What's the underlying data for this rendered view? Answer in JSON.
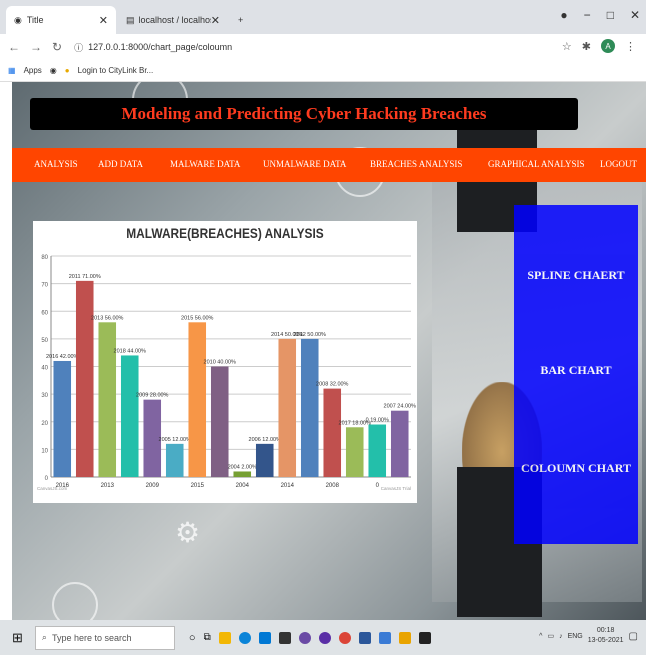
{
  "browser": {
    "tabs": [
      {
        "label": "Title"
      },
      {
        "label": "localhost / localhost / hacking /"
      }
    ],
    "new_tab_label": "+",
    "url": "127.0.0.1:8000/chart_page/coloumn",
    "bookmarks": [
      {
        "label": "Apps"
      },
      {
        "label": "Login to CityLink Br..."
      }
    ],
    "avatar_letter": "A"
  },
  "page": {
    "title": "Modeling and Predicting Cyber Hacking Breaches",
    "menu": [
      {
        "label": "ANALYSIS"
      },
      {
        "label": "ADD DATA"
      },
      {
        "label": "MALWARE DATA"
      },
      {
        "label": "UNMALWARE DATA"
      },
      {
        "label": "BREACHES ANALYSIS"
      },
      {
        "label": "GRAPHICAL ANALYSIS"
      },
      {
        "label": "LOGOUT"
      }
    ],
    "side_links": [
      {
        "label": "SPLINE CHAERT"
      },
      {
        "label": "BAR CHART"
      },
      {
        "label": "COLOUMN CHART"
      }
    ]
  },
  "chart_data": {
    "type": "bar",
    "title": "MALWARE(BREACHES) ANALYSIS",
    "ylim": [
      0,
      80
    ],
    "yticks": [
      0,
      10,
      20,
      30,
      40,
      50,
      60,
      70,
      80
    ],
    "xticks": [
      "2016",
      "2013",
      "2009",
      "2015",
      "2004",
      "2014",
      "2008",
      "0"
    ],
    "credits_left": "CanvasJS.com",
    "credits_right": "CanvasJS Trial",
    "bars": [
      {
        "year": "2016",
        "value": 42,
        "label": "2016 42.00%",
        "color": "#4f81bc"
      },
      {
        "year": "2011",
        "value": 71,
        "label": "2011 71.00%",
        "color": "#c0504e"
      },
      {
        "year": "2013",
        "value": 56,
        "label": "2013 56.00%",
        "color": "#9bbb58"
      },
      {
        "year": "2018",
        "value": 44,
        "label": "2018 44.00%",
        "color": "#23bfaa"
      },
      {
        "year": "2009",
        "value": 28,
        "label": "2009 28.00%",
        "color": "#8064a1"
      },
      {
        "year": "2005",
        "value": 12,
        "label": "2005 12.00%",
        "color": "#4aacc5"
      },
      {
        "year": "2015",
        "value": 56,
        "label": "2015 56.00%",
        "color": "#f79647"
      },
      {
        "year": "2010",
        "value": 40,
        "label": "2010 40.00%",
        "color": "#7f6084"
      },
      {
        "year": "2004",
        "value": 2,
        "label": "2004 2.00%",
        "color": "#77a033"
      },
      {
        "year": "2006",
        "value": 12,
        "label": "2006 12.00%",
        "color": "#33558b"
      },
      {
        "year": "2014",
        "value": 50,
        "label": "2014 50.00%",
        "color": "#e59566"
      },
      {
        "year": "2012",
        "value": 50,
        "label": "2012 50.00%",
        "color": "#4f81bc"
      },
      {
        "year": "2008",
        "value": 32,
        "label": "2008 32.00%",
        "color": "#c0504e"
      },
      {
        "year": "2017",
        "value": 18,
        "label": "2017 18.00%",
        "color": "#9bbb58"
      },
      {
        "year": "0",
        "value": 19,
        "label": "0 19.00%",
        "color": "#23bfaa"
      },
      {
        "year": "2007",
        "value": 24,
        "label": "2007 24.00%",
        "color": "#8064a1"
      }
    ]
  },
  "taskbar": {
    "search_placeholder": "Type here to search",
    "lang": "ENG",
    "time": "00:18",
    "date": "13-05-2021"
  }
}
